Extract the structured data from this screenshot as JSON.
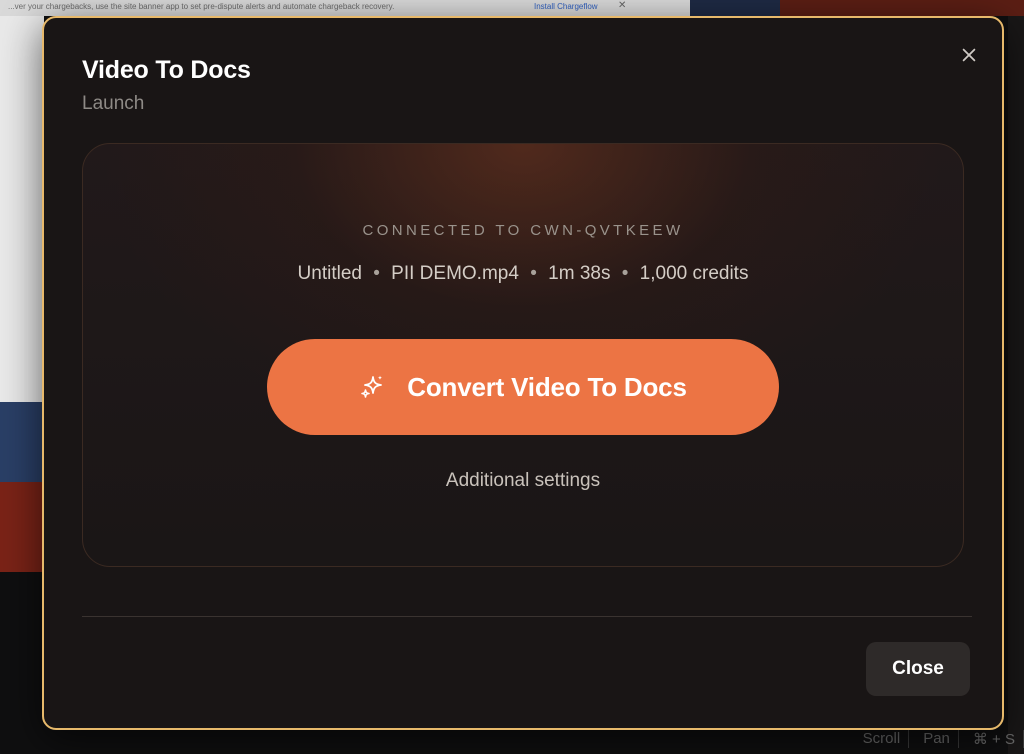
{
  "background": {
    "banner_text": "...ver your chargebacks, use the site banner app to set pre-dispute alerts and automate chargeback recovery.",
    "banner_link": "Install Chargeflow",
    "bottom_controls": [
      "Scroll",
      "Pan",
      "⌘ + S"
    ]
  },
  "modal": {
    "title": "Video To Docs",
    "subtitle": "Launch",
    "close_icon": "close-icon",
    "connected_label": "CONNECTED TO CWN-QVTKEEW",
    "meta": {
      "name": "Untitled",
      "file": "PII DEMO.mp4",
      "duration": "1m 38s",
      "credits": "1,000 credits",
      "separator": "•"
    },
    "convert_button": {
      "label": "Convert Video To Docs",
      "icon": "sparkle-icon"
    },
    "additional_settings": "Additional settings",
    "close_button": "Close"
  },
  "colors": {
    "accent": "#ec7444",
    "modal_border": "#e7b96b",
    "modal_bg": "#191515",
    "muted_text": "#8e8a86"
  }
}
